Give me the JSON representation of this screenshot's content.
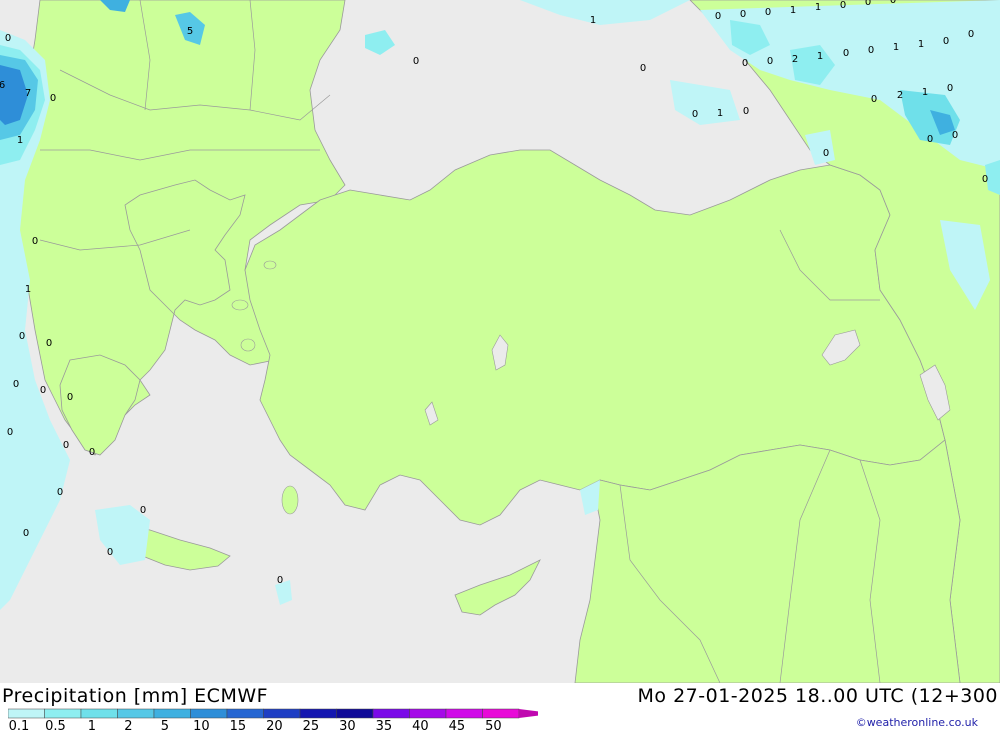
{
  "header": {
    "title": "Precipitation [mm] ECMWF",
    "datetime": "Mo 27-01-2025 18..00 UTC (12+300",
    "credit": "©weatheronline.co.uk"
  },
  "legend": {
    "tick_labels": [
      "0.1",
      "0.5",
      "1",
      "2",
      "5",
      "10",
      "15",
      "20",
      "25",
      "30",
      "35",
      "40",
      "45",
      "50"
    ],
    "colors": [
      "#bff5f7",
      "#8eeef0",
      "#6fe0ea",
      "#56c8e6",
      "#3fb0e0",
      "#2e8ed8",
      "#2666d2",
      "#1e3ec4",
      "#1416b0",
      "#100a98",
      "#7a0ae8",
      "#a50ae8",
      "#d00ae8",
      "#e80ad8",
      "#c008b0"
    ]
  },
  "map": {
    "land_color": "#ccff99",
    "sea_color": "#ebebeb",
    "precip_labels": [
      {
        "text": "5"
      },
      {
        "text": "0"
      },
      {
        "text": "6"
      },
      {
        "text": "7"
      },
      {
        "text": "0"
      },
      {
        "text": "1"
      },
      {
        "text": "0"
      },
      {
        "text": "1"
      },
      {
        "text": "0"
      },
      {
        "text": "0"
      },
      {
        "text": "0"
      },
      {
        "text": "0"
      },
      {
        "text": "0"
      },
      {
        "text": "0"
      },
      {
        "text": "0"
      },
      {
        "text": "0"
      },
      {
        "text": "0"
      },
      {
        "text": "0"
      },
      {
        "text": "0"
      },
      {
        "text": "0"
      },
      {
        "text": "0"
      },
      {
        "text": "0"
      },
      {
        "text": "1"
      },
      {
        "text": "0"
      },
      {
        "text": "0"
      },
      {
        "text": "0"
      },
      {
        "text": "0"
      },
      {
        "text": "1"
      },
      {
        "text": "1"
      },
      {
        "text": "0"
      },
      {
        "text": "0"
      },
      {
        "text": "0"
      },
      {
        "text": "0"
      },
      {
        "text": "0"
      },
      {
        "text": "2"
      },
      {
        "text": "1"
      },
      {
        "text": "0"
      },
      {
        "text": "0"
      },
      {
        "text": "1"
      },
      {
        "text": "1"
      },
      {
        "text": "0"
      },
      {
        "text": "0"
      },
      {
        "text": "0"
      },
      {
        "text": "2"
      },
      {
        "text": "1"
      },
      {
        "text": "0"
      },
      {
        "text": "0"
      },
      {
        "text": "1"
      },
      {
        "text": "0"
      },
      {
        "text": "0"
      },
      {
        "text": "0"
      },
      {
        "text": "0"
      },
      {
        "text": "0"
      }
    ]
  }
}
